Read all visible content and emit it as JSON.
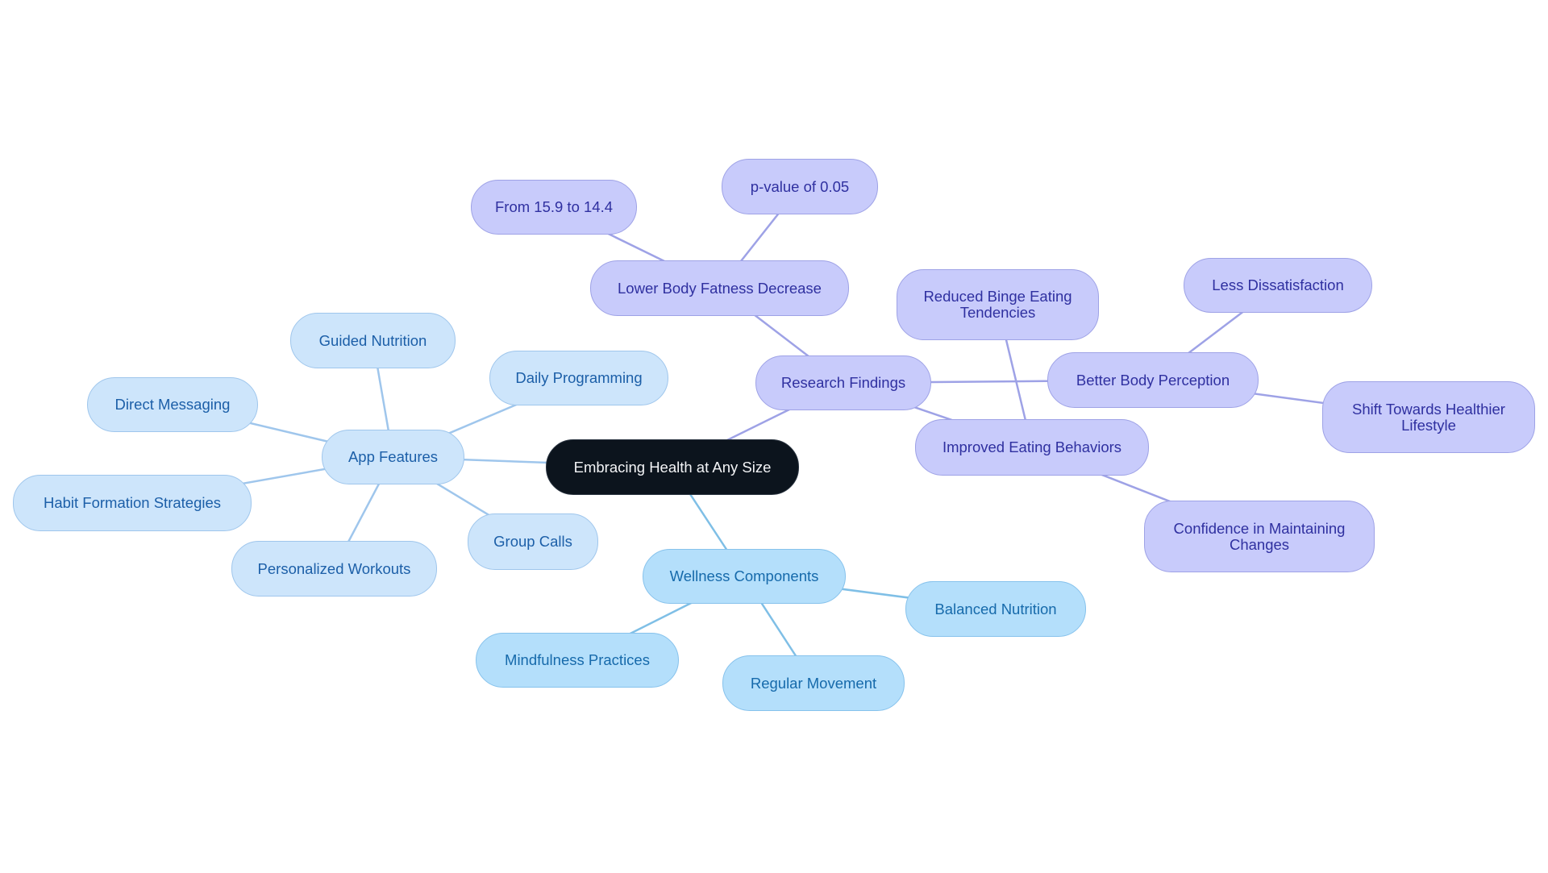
{
  "diagram": {
    "type": "mind-map",
    "colors": {
      "root_fill": "#0c141d",
      "root_text": "#f3f4f6",
      "app_features_fill": "#cde5fb",
      "app_features_edge": "#9fc6ec",
      "wellness_fill": "#b4dffb",
      "wellness_edge": "#7fbfe6",
      "research_fill": "#c8cbfb",
      "research_edge": "#9ea2e6"
    },
    "root": {
      "id": "root",
      "label": "Embracing Health at Any Size"
    },
    "nodes": [
      {
        "id": "app",
        "label": "App Features",
        "parent": "root",
        "group": "blue1"
      },
      {
        "id": "guided",
        "label": "Guided Nutrition",
        "parent": "app",
        "group": "blue1"
      },
      {
        "id": "daily",
        "label": "Daily Programming",
        "parent": "app",
        "group": "blue1"
      },
      {
        "id": "direct",
        "label": "Direct Messaging",
        "parent": "app",
        "group": "blue1"
      },
      {
        "id": "habit",
        "label": "Habit Formation Strategies",
        "parent": "app",
        "group": "blue1"
      },
      {
        "id": "personal",
        "label": "Personalized Workouts",
        "parent": "app",
        "group": "blue1"
      },
      {
        "id": "group",
        "label": "Group Calls",
        "parent": "app",
        "group": "blue1"
      },
      {
        "id": "wellness",
        "label": "Wellness Components",
        "parent": "root",
        "group": "blue2"
      },
      {
        "id": "balanced",
        "label": "Balanced Nutrition",
        "parent": "wellness",
        "group": "blue2"
      },
      {
        "id": "mindful",
        "label": "Mindfulness Practices",
        "parent": "wellness",
        "group": "blue2"
      },
      {
        "id": "movement",
        "label": "Regular Movement",
        "parent": "wellness",
        "group": "blue2"
      },
      {
        "id": "research",
        "label": "Research Findings",
        "parent": "root",
        "group": "purple"
      },
      {
        "id": "fatness",
        "label": "Lower Body Fatness Decrease",
        "parent": "research",
        "group": "purple"
      },
      {
        "id": "from",
        "label": "From 15.9 to 14.4",
        "parent": "fatness",
        "group": "purple"
      },
      {
        "id": "pvalue",
        "label": "p-value of 0.05",
        "parent": "fatness",
        "group": "purple"
      },
      {
        "id": "perception",
        "label": "Better Body Perception",
        "parent": "research",
        "group": "purple"
      },
      {
        "id": "less",
        "label": "Less Dissatisfaction",
        "parent": "perception",
        "group": "purple"
      },
      {
        "id": "shift",
        "label": "Shift Towards Healthier Lifestyle",
        "parent": "perception",
        "group": "purple"
      },
      {
        "id": "eating",
        "label": "Improved Eating Behaviors",
        "parent": "research",
        "group": "purple"
      },
      {
        "id": "binge",
        "label": "Reduced Binge Eating Tendencies",
        "parent": "eating",
        "group": "purple"
      },
      {
        "id": "confidence",
        "label": "Confidence in Maintaining Changes",
        "parent": "eating",
        "group": "purple"
      }
    ]
  }
}
